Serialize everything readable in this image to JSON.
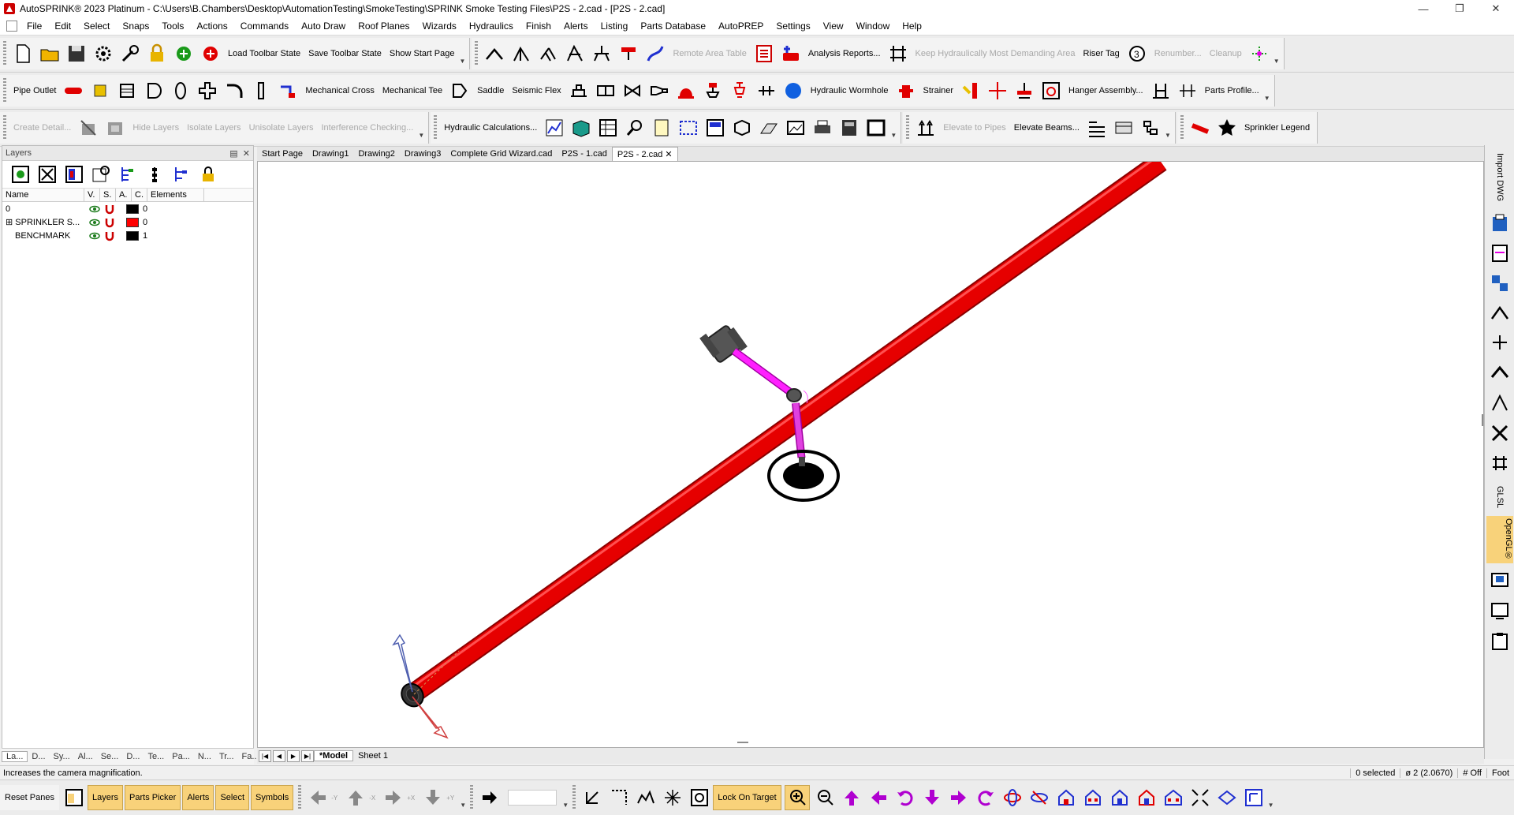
{
  "window": {
    "title": "AutoSPRINK® 2023 Platinum - C:\\Users\\B.Chambers\\Desktop\\AutomationTesting\\SmokeTesting\\SPRINK Smoke Testing Files\\P2S - 2.cad - [P2S - 2.cad]"
  },
  "menu": [
    "File",
    "Edit",
    "Select",
    "Snaps",
    "Tools",
    "Actions",
    "Commands",
    "Auto Draw",
    "Roof Planes",
    "Wizards",
    "Hydraulics",
    "Finish",
    "Alerts",
    "Listing",
    "Parts Database",
    "AutoPREP",
    "Settings",
    "View",
    "Window",
    "Help"
  ],
  "toolbar1": {
    "load": "Load Toolbar State",
    "save": "Save Toolbar State",
    "start": "Show Start Page",
    "remote_area": "Remote Area Table",
    "analysis": "Analysis Reports...",
    "keep_demanding": "Keep Hydraulically Most Demanding Area",
    "riser_tag": "Riser Tag",
    "renumber": "Renumber...",
    "cleanup": "Cleanup"
  },
  "toolbar2": {
    "pipe_outlet": "Pipe Outlet",
    "mech_cross": "Mechanical Cross",
    "mech_tee": "Mechanical Tee",
    "saddle": "Saddle",
    "seismic_flex": "Seismic Flex",
    "wormhole": "Hydraulic Wormhole",
    "strainer": "Strainer",
    "hanger_assembly": "Hanger Assembly...",
    "parts_profile": "Parts Profile..."
  },
  "toolbar3": {
    "create_detail": "Create Detail...",
    "hide_layers": "Hide Layers",
    "isolate_layers": "Isolate Layers",
    "unisolate_layers": "Unisolate Layers",
    "interference": "Interference Checking...",
    "hydraulic_calc": "Hydraulic Calculations...",
    "elevate_pipes": "Elevate to Pipes",
    "elevate_beams": "Elevate Beams...",
    "sprinkler_legend": "Sprinkler Legend"
  },
  "layers_panel": {
    "title": "Layers",
    "columns": [
      "Name",
      "V.",
      "S.",
      "A.",
      "C.",
      "Elements"
    ],
    "rows": [
      {
        "name": "0",
        "color": "#000000",
        "count": "0"
      },
      {
        "name": "SPRINKLER S...",
        "color": "#ff0000",
        "count": "0"
      },
      {
        "name": "BENCHMARK",
        "color": "#000000",
        "count": "1"
      }
    ]
  },
  "panel_tabs": [
    "La...",
    "D...",
    "Sy...",
    "Al...",
    "Se...",
    "D...",
    "Te...",
    "Pa...",
    "N...",
    "Tr...",
    "Fa..."
  ],
  "doc_tabs": [
    "Start Page",
    "Drawing1",
    "Drawing2",
    "Drawing3",
    "Complete Grid Wizard.cad",
    "P2S - 1.cad",
    "P2S - 2.cad"
  ],
  "active_doc_tab": "P2S - 2.cad",
  "sheet_tabs": [
    "*Model",
    "Sheet 1"
  ],
  "right_sidebar": {
    "import": "Import DWG",
    "glsl": "GLSL",
    "opengl": "OpenGL®"
  },
  "status": {
    "message": "Increases the camera magnification.",
    "selected": "0 selected",
    "diameter": "ø 2 (2.0670)",
    "snap": "# Off",
    "units": "Foot"
  },
  "bottom_bar": {
    "reset_panes": "Reset Panes",
    "panes": [
      "Layers",
      "Parts Picker",
      "Alerts",
      "Select",
      "Symbols"
    ],
    "axes": [
      "-Y",
      "-X",
      "+X",
      "+Y",
      "-Y",
      "-X"
    ],
    "lock_on_target": "Lock On Target"
  },
  "colors": {
    "pipe": "#ff0000",
    "armover": "#e600e6",
    "fitting": "#555555",
    "accent": "#f8d27a"
  }
}
